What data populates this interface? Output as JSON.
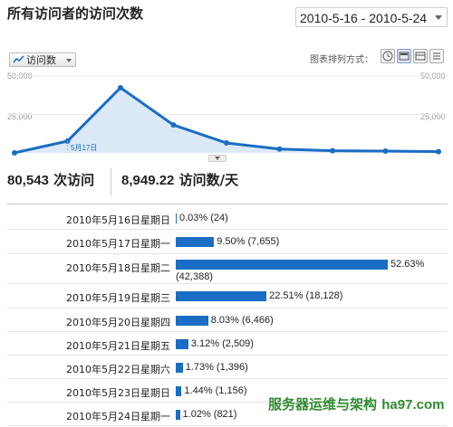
{
  "header": {
    "title": "所有访问者的访问次数",
    "date_range": "2010-5-16 - 2010-5-24"
  },
  "toolbar": {
    "metric_label": "访问数",
    "chart_mode_label": "图表排列方式：",
    "modes": [
      "clock-icon",
      "line-chart-icon",
      "table-icon",
      "list-icon"
    ]
  },
  "chart": {
    "y_left_ticks": [
      "50,000",
      "25,000"
    ],
    "y_right_ticks": [
      "50,000",
      "25,000"
    ],
    "point_label": "5月17日",
    "series": [
      24,
      7655,
      42388,
      18128,
      6466,
      2509,
      1396,
      1156,
      821
    ],
    "ylim": [
      0,
      50000
    ],
    "line_color": "#1a6dc4",
    "fill_color": "#dbe9f7"
  },
  "summary": {
    "visits": "80,543",
    "visits_unit": "次访问",
    "per_day": "8,949.22",
    "per_day_unit": "访问数/天"
  },
  "rows": [
    {
      "date": "2010年5月16日星期日",
      "pct": 0.03,
      "label": "0.03% (24)"
    },
    {
      "date": "2010年5月17日星期一",
      "pct": 9.5,
      "label": "9.50% (7,655)"
    },
    {
      "date": "2010年5月18日星期二",
      "pct": 52.63,
      "label": "52.63%",
      "label2": "(42,388)"
    },
    {
      "date": "2010年5月19日星期三",
      "pct": 22.51,
      "label": "22.51% (18,128)"
    },
    {
      "date": "2010年5月20日星期四",
      "pct": 8.03,
      "label": "8.03% (6,466)"
    },
    {
      "date": "2010年5月21日星期五",
      "pct": 3.12,
      "label": "3.12% (2,509)"
    },
    {
      "date": "2010年5月22日星期六",
      "pct": 1.73,
      "label": "1.73% (1,396)"
    },
    {
      "date": "2010年5月23日星期日",
      "pct": 1.44,
      "label": "1.44% (1,156)"
    },
    {
      "date": "2010年5月24日星期一",
      "pct": 1.02,
      "label": "1.02% (821)"
    }
  ],
  "watermark": {
    "text": "服务器运维与架构",
    "domain": "ha97.com"
  }
}
